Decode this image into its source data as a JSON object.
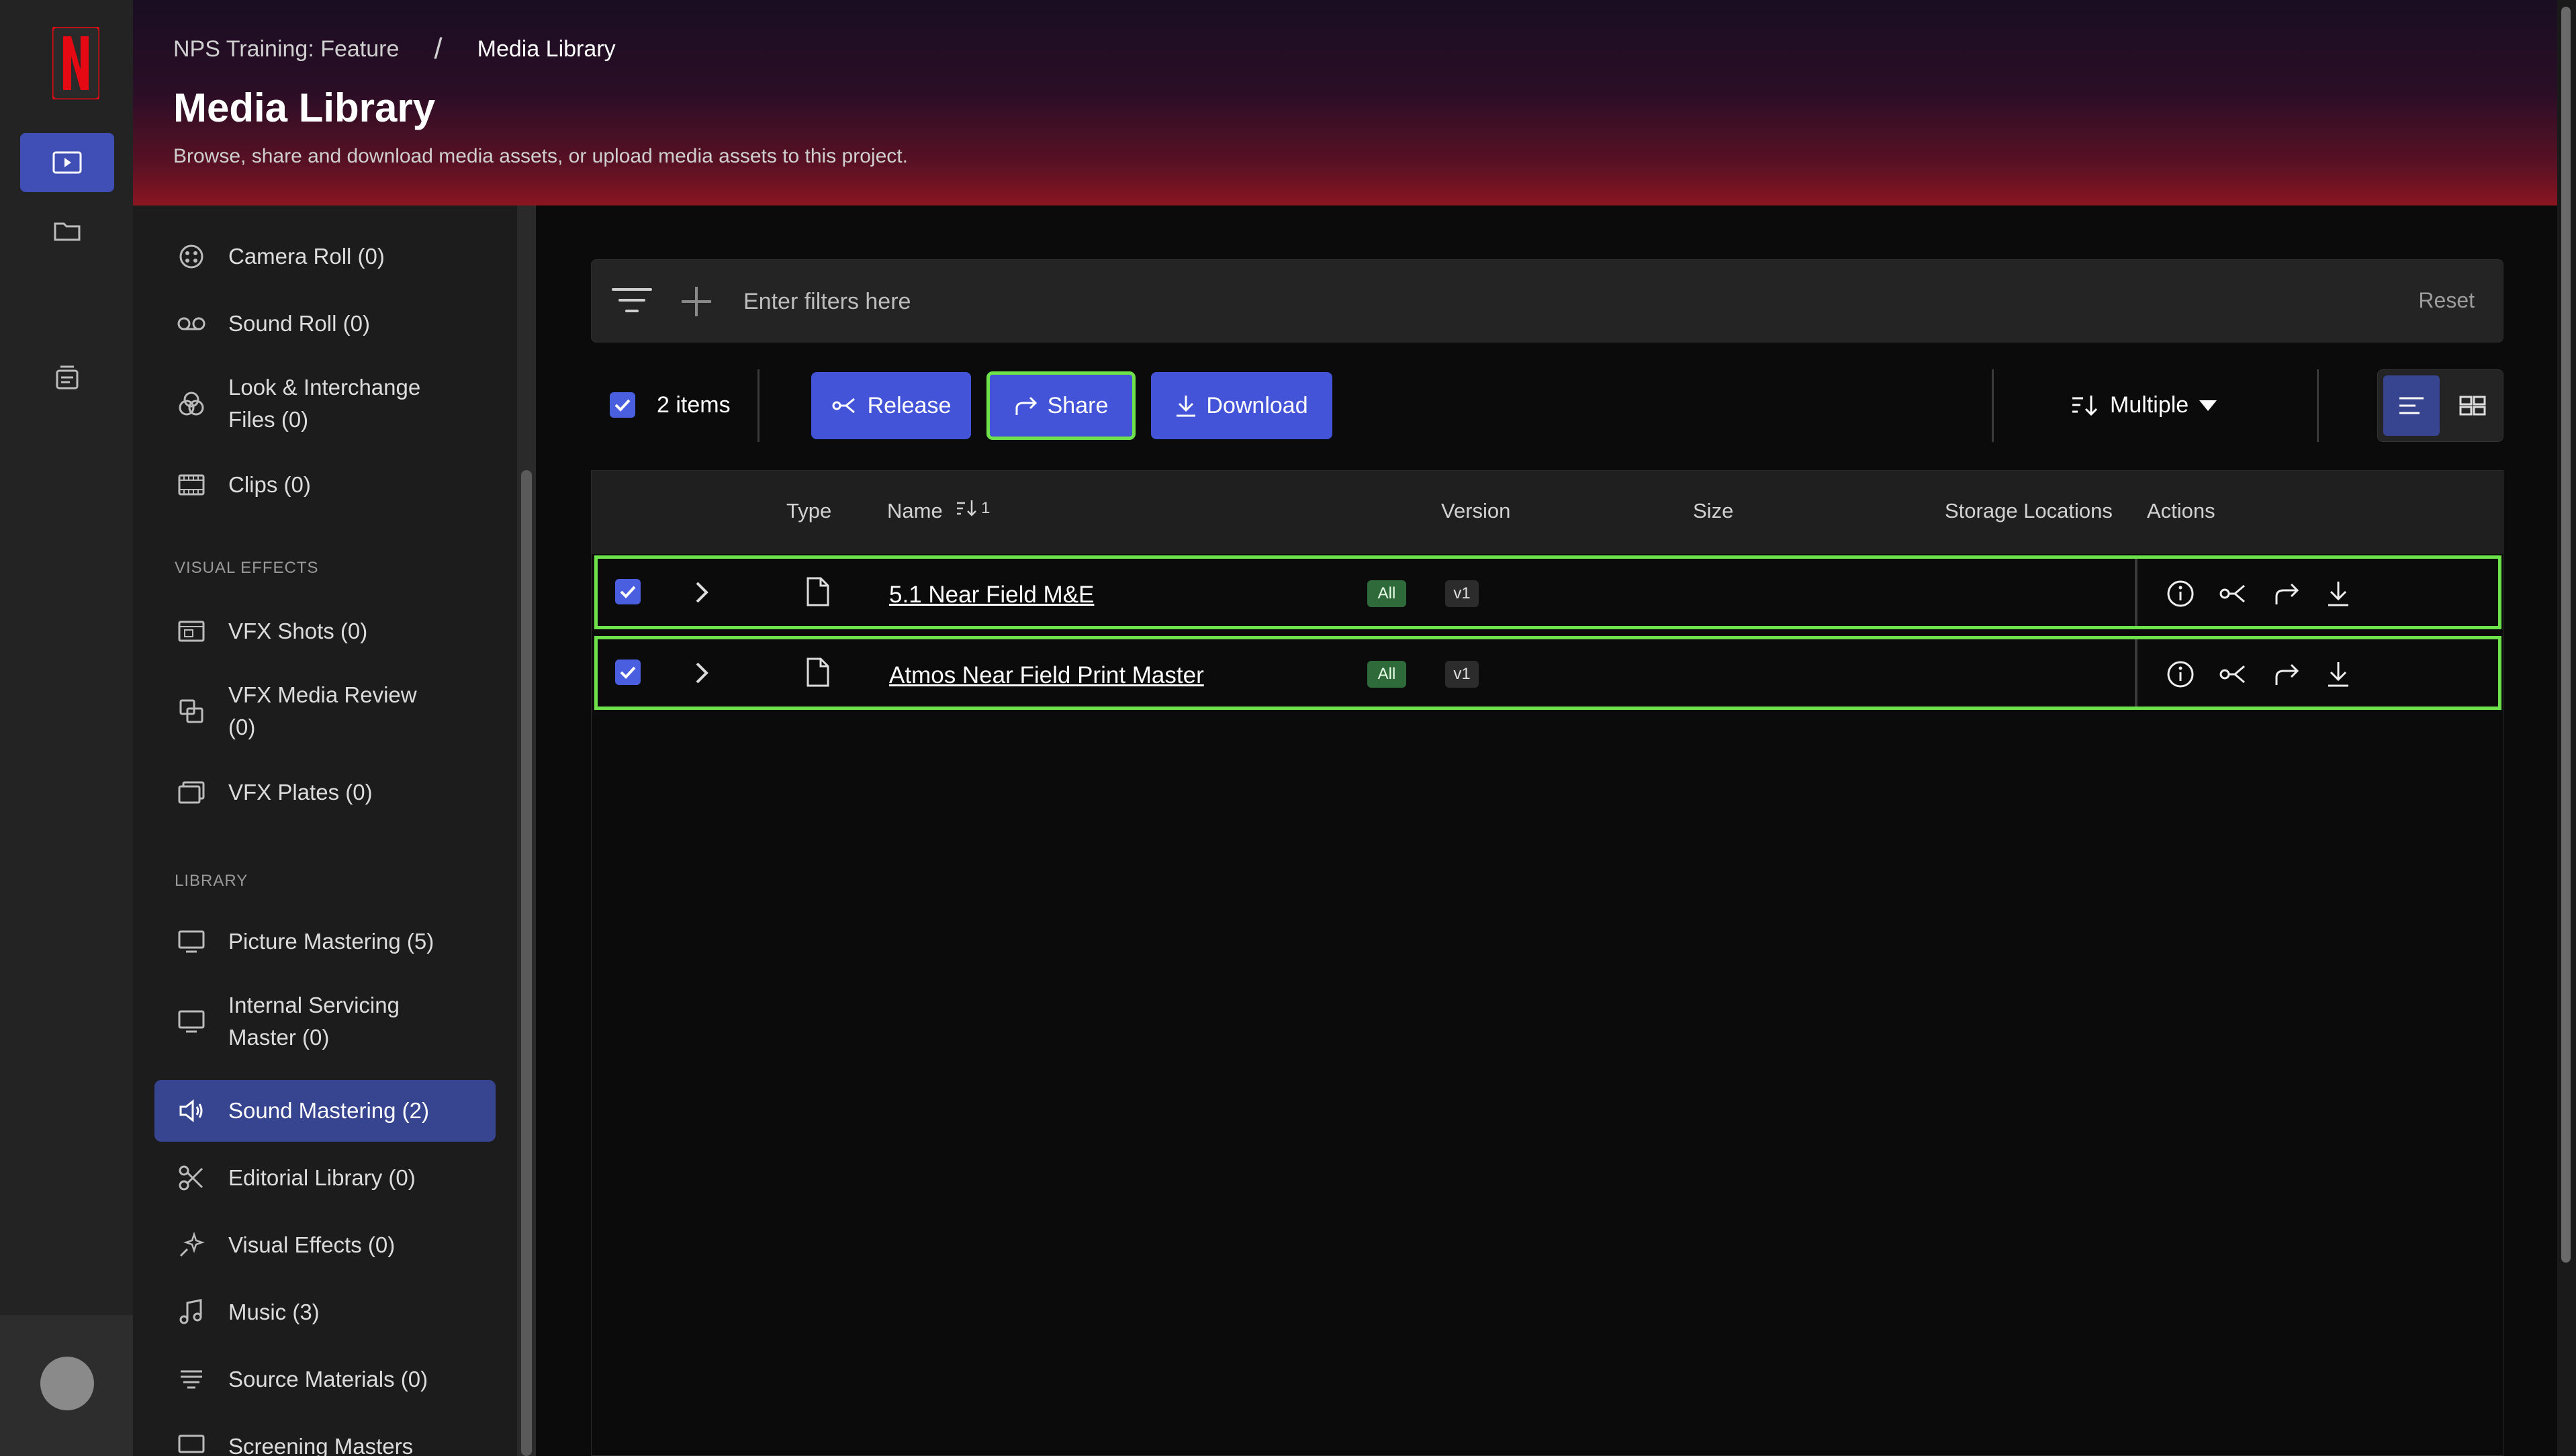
{
  "breadcrumb": {
    "project": "NPS Training: Feature",
    "separator": "/",
    "current": "Media Library"
  },
  "header": {
    "title": "Media Library",
    "subtitle": "Browse, share and download media assets, or upload media assets to this project."
  },
  "sidebar": {
    "items_top": [
      {
        "label": "Camera Roll (0)",
        "icon": "camera-roll-icon"
      },
      {
        "label": "Sound Roll (0)",
        "icon": "voicemail-icon"
      },
      {
        "label": "Look & Interchange",
        "label2": "Files (0)",
        "icon": "color-wheel-icon"
      },
      {
        "label": "Clips (0)",
        "icon": "filmstrip-icon"
      }
    ],
    "section_vfx": "VISUAL EFFECTS",
    "items_vfx": [
      {
        "label": "VFX Shots (0)",
        "icon": "vfx-shot-icon"
      },
      {
        "label": "VFX Media Review",
        "label2": "(0)",
        "icon": "vfx-review-icon"
      },
      {
        "label": "VFX Plates (0)",
        "icon": "vfx-plates-icon"
      }
    ],
    "section_library": "LIBRARY",
    "items_library": [
      {
        "label": "Picture Mastering (5)",
        "icon": "monitor-icon"
      },
      {
        "label": "Internal Servicing",
        "label2": "Master (0)",
        "icon": "monitor-icon"
      },
      {
        "label": "Sound Mastering (2)",
        "icon": "speaker-icon",
        "active": true
      },
      {
        "label": "Editorial Library (0)",
        "icon": "scissors-icon"
      },
      {
        "label": "Visual Effects (0)",
        "icon": "sparkle-icon"
      },
      {
        "label": "Music (3)",
        "icon": "music-note-icon"
      },
      {
        "label": "Source Materials (0)",
        "icon": "layers-icon"
      },
      {
        "label": "Screening Masters",
        "icon": "screening-icon"
      }
    ]
  },
  "filter": {
    "placeholder": "Enter filters here",
    "reset_label": "Reset"
  },
  "toolbar": {
    "selected_count": "2 items",
    "release_label": "Release",
    "share_label": "Share",
    "download_label": "Download",
    "sort_label": "Multiple"
  },
  "table": {
    "columns": {
      "type": "Type",
      "name": "Name",
      "name_sort": "1",
      "version": "Version",
      "size": "Size",
      "storage": "Storage Locations",
      "actions": "Actions"
    },
    "rows": [
      {
        "name": "5.1 Near Field M&E",
        "badge": "All",
        "version": "v1"
      },
      {
        "name": "Atmos Near Field Print Master",
        "badge": "All",
        "version": "v1"
      }
    ]
  },
  "colors": {
    "accent": "#4354d8",
    "highlight": "#6ee24a",
    "active_nav": "#37448f",
    "badge_green": "#2f6a3a"
  }
}
